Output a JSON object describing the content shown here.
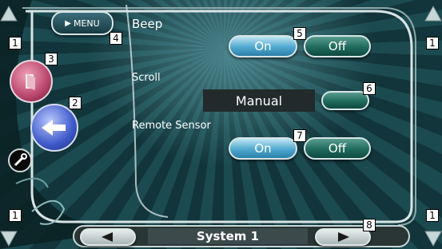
{
  "header": {
    "menu_label": "MENU",
    "setting_title": "Beep"
  },
  "settings": {
    "beep": {
      "on_label": "On",
      "off_label": "Off",
      "selected": "On"
    },
    "scroll": {
      "label": "Scroll",
      "value": "Manual"
    },
    "remote_sensor": {
      "label": "Remote Sensor",
      "on_label": "On",
      "off_label": "Off",
      "selected": "On"
    }
  },
  "footer": {
    "page_title": "System 1"
  },
  "callouts": {
    "n1": "1",
    "n2": "2",
    "n3": "3",
    "n4": "4",
    "n5": "5",
    "n6": "6",
    "n7": "7",
    "n8": "8"
  },
  "colors": {
    "accent_on": "#4fa8cf",
    "off_button": "#1f6a5c",
    "panel": "#0f2f33"
  },
  "icons": [
    "scroll-up-arrow-icon",
    "scroll-down-arrow-icon",
    "exit-icon",
    "return-icon",
    "wrench-icon",
    "play-menu-icon",
    "left-arrow-icon",
    "right-arrow-icon"
  ]
}
